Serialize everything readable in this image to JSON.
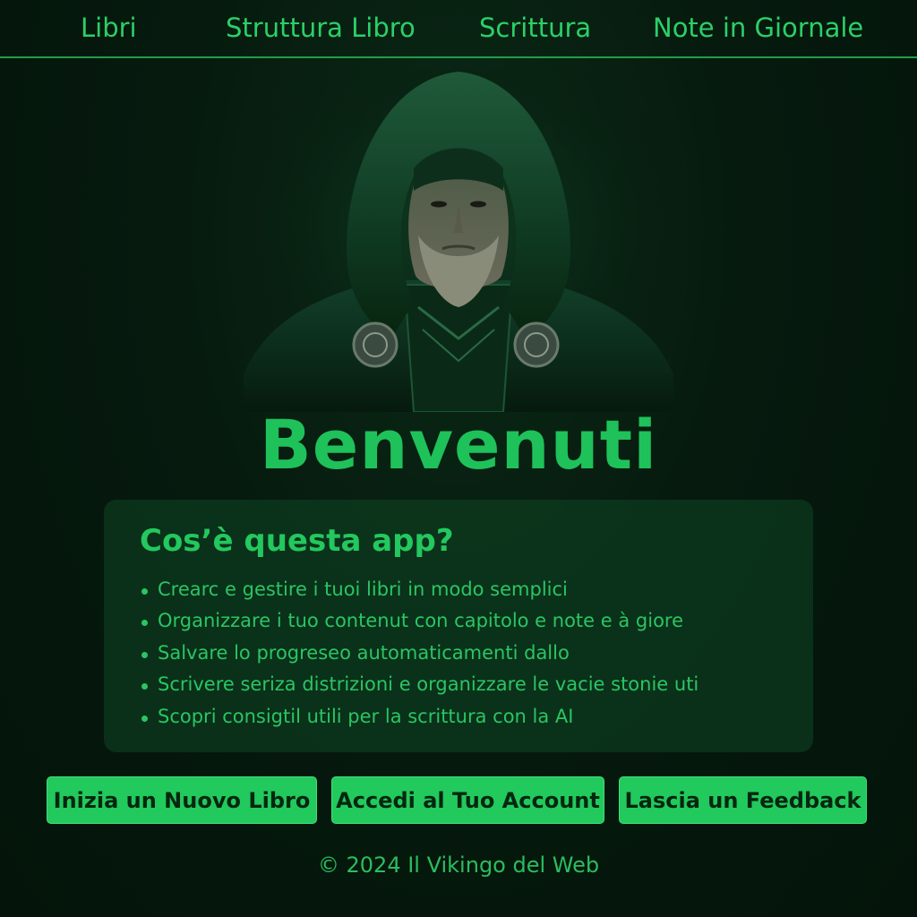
{
  "nav": {
    "items": [
      {
        "label": "Libri"
      },
      {
        "label": "Struttura Libro"
      },
      {
        "label": "Scrittura"
      },
      {
        "label": "Note in Giornale"
      }
    ]
  },
  "hero": {
    "image": "hooded-viking-portrait"
  },
  "welcome": {
    "title": "Benvenuti"
  },
  "about": {
    "title": "Cos’è questa app?",
    "features": [
      "Crearc e gestire i tuoi libri in modo semplici",
      "Organizzare i tuo contenut con capitolo e note e à giore",
      "Salvare lo progreseo automaticamenti dallo",
      "Scrivere seriza distrizioni e organizzare le vacie stonie uti",
      "Scopri consigtil utili per la scrittura con la AI"
    ]
  },
  "actions": {
    "new_book": "Inizia un Nuovo Libro",
    "login": "Accedi al Tuo Account",
    "feedback": "Lascia un Feedback"
  },
  "footer": {
    "text": "© 2024  Il Vikingo del Web"
  },
  "colors": {
    "background": "#04140a",
    "accent": "#22c95c",
    "text": "#2bc563"
  }
}
